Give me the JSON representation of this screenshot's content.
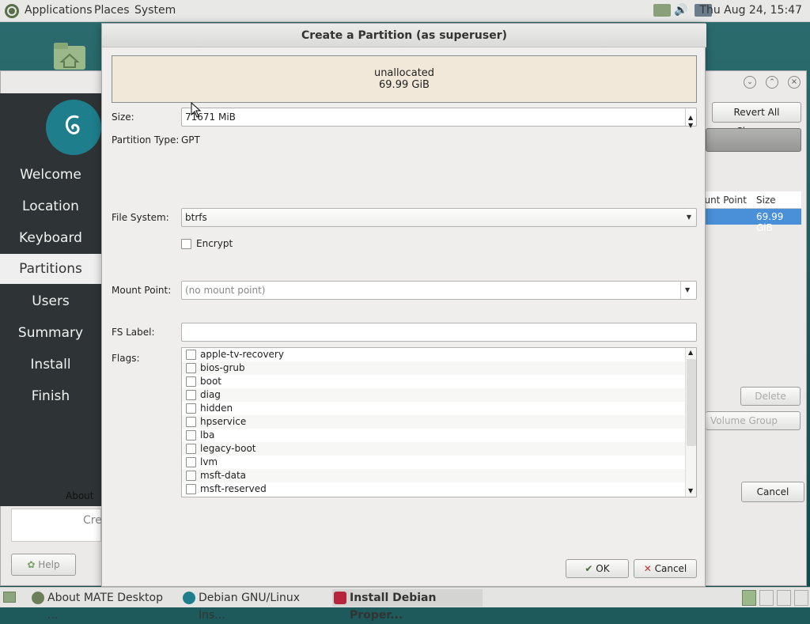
{
  "top_panel": {
    "menu": [
      "Applications",
      "Places",
      "System"
    ],
    "clock": "Thu Aug 24, 15:47"
  },
  "background_window": {
    "sidebar": [
      "Welcome",
      "Location",
      "Keyboard",
      "Partitions",
      "Users",
      "Summary",
      "Install",
      "Finish"
    ],
    "about_label": "About",
    "help_button": "Help",
    "revert_button": "Revert All Changes",
    "columns": [
      "Mount Point",
      "Size"
    ],
    "row_size": "69.99 GiB",
    "delete_button": "Delete",
    "volume_group_button": "Volume Group",
    "cancel_button": "Cancel",
    "create_partial": "Cre"
  },
  "dialog": {
    "title": "Create a Partition (as superuser)",
    "region_label": "unallocated",
    "region_size": "69.99 GiB",
    "size_label": "Size:",
    "size_value": "71671 MiB",
    "partition_type_label": "Partition Type:",
    "partition_type_value": "GPT",
    "file_system_label": "File System:",
    "file_system_value": "btrfs",
    "encrypt_label": "Encrypt",
    "encrypt_checked": false,
    "mount_point_label": "Mount Point:",
    "mount_point_placeholder": "(no mount point)",
    "fs_label_label": "FS Label:",
    "fs_label_value": "",
    "flags_label": "Flags:",
    "flags": [
      "apple-tv-recovery",
      "bios-grub",
      "boot",
      "diag",
      "hidden",
      "hpservice",
      "lba",
      "legacy-boot",
      "lvm",
      "msft-data",
      "msft-reserved"
    ],
    "ok_button": "OK",
    "cancel_button": "Cancel"
  },
  "taskbar": {
    "tasks": [
      "About MATE Desktop ...",
      "Debian GNU/Linux Ins...",
      "Install Debian Proper..."
    ]
  },
  "colors": {
    "accent_selection": "#4a90d9",
    "sidebar_bg": "#2e3436",
    "unallocated_bg": "#f1e8d9"
  }
}
